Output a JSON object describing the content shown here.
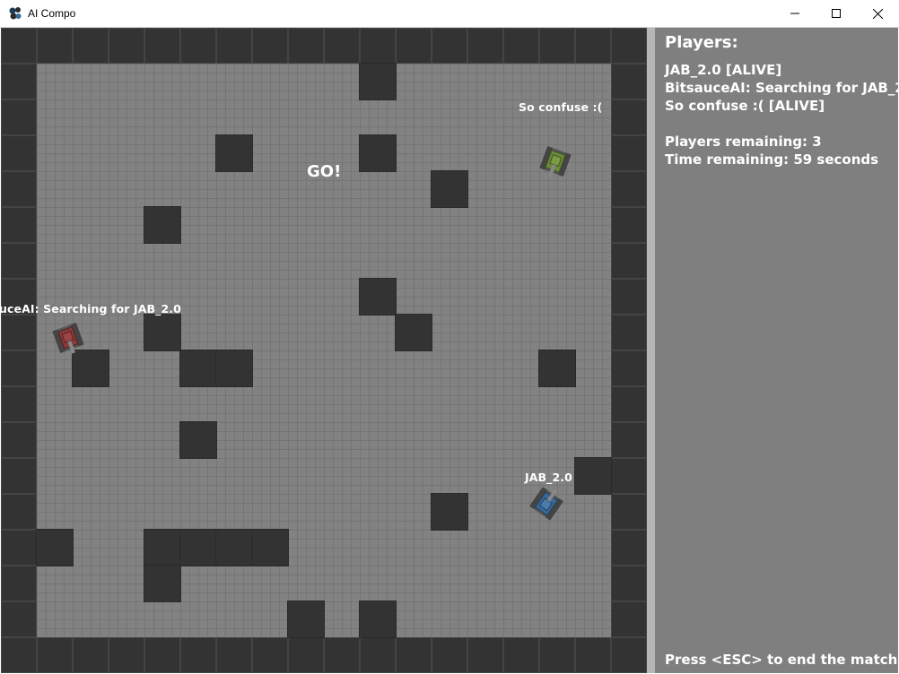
{
  "window": {
    "title": "AI Compo",
    "controls": [
      "minimize",
      "maximize",
      "close"
    ]
  },
  "game": {
    "banner": "GO!",
    "tanks": [
      {
        "label": "So confuse :(",
        "color": "#6b8a3a",
        "heading": "down-left"
      },
      {
        "label": "uceAI: Searching for JAB_2.0",
        "color": "#8a3a3a",
        "heading": "down-right"
      },
      {
        "label": "JAB_2.0",
        "color": "#3a6a9a",
        "heading": "up-left"
      }
    ]
  },
  "panel": {
    "heading": "Players:",
    "players": [
      "JAB_2.0 [ALIVE]",
      "BitsauceAI: Searching for JAB_2",
      "So confuse :( [ALIVE]"
    ],
    "players_remaining": "Players remaining: 3",
    "time_remaining": "Time remaining: 59 seconds",
    "footer": "Press <ESC> to end the match"
  },
  "colors": {
    "wall": "#333333",
    "floor": "#828282",
    "panel": "#7f7f7f",
    "divider": "#b6b6b6"
  }
}
